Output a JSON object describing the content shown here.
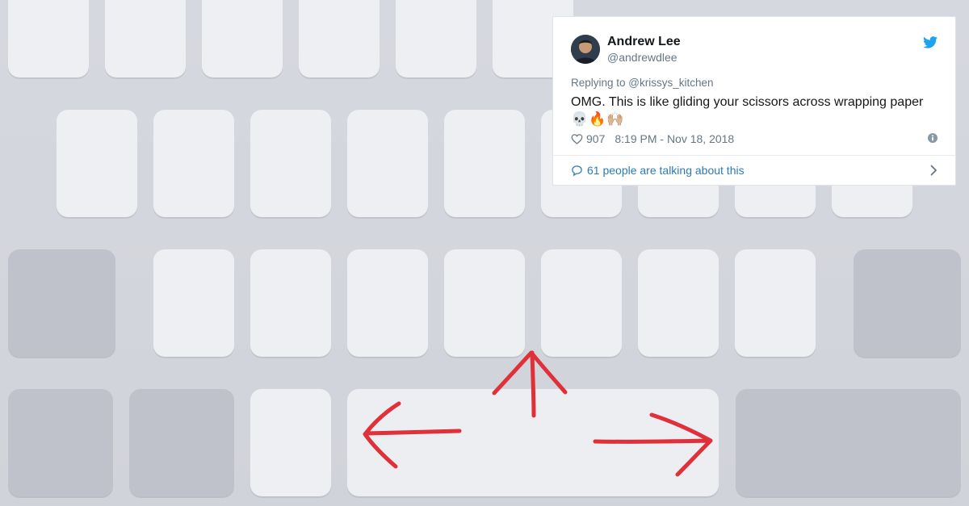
{
  "tweet": {
    "author_name": "Andrew Lee",
    "author_handle": "@andrewdlee",
    "reply_prefix": "Replying to ",
    "reply_handle": "@krissys_kitchen",
    "text": "OMG. This is like gliding your scissors across wrapping paper",
    "emojis": "💀🔥🙌🏼",
    "likes": "907",
    "timestamp": "8:19 PM - Nov 18, 2018",
    "talking": "61 people are talking about this",
    "icons": [
      "twitter-bird-icon",
      "heart-icon",
      "info-icon",
      "speech-bubble-icon",
      "chevron-right-icon"
    ],
    "colors": {
      "link": "#2b7bb9",
      "brand": "#1da1f2",
      "muted": "#657786"
    }
  },
  "annotation": {
    "arrows": [
      "left",
      "up",
      "right"
    ],
    "color": "#e0303a"
  }
}
